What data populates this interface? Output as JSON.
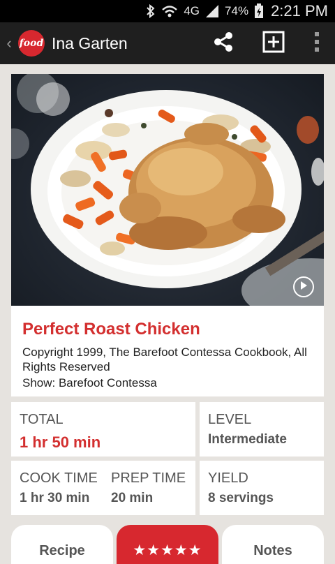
{
  "status_bar": {
    "network": "4G",
    "battery": "74%",
    "time": "2:21 PM"
  },
  "app_bar": {
    "logo_text": "food",
    "title": "Ina Garten",
    "icons": [
      "back-icon",
      "share-icon",
      "add-icon",
      "overflow-menu-icon"
    ]
  },
  "recipe": {
    "title": "Perfect Roast Chicken",
    "copyright": "Copyright 1999, The Barefoot Contessa Cookbook, All Rights Reserved",
    "show": "Show: Barefoot Contessa",
    "image_alt": "roast chicken on platter with carrots and onions"
  },
  "details": {
    "total_label": "TOTAL",
    "total_value": "1 hr 50 min",
    "level_label": "LEVEL",
    "level_value": "Intermediate",
    "cook_label": "COOK TIME",
    "cook_value": "1 hr 30 min",
    "prep_label": "PREP TIME",
    "prep_value": "20 min",
    "yield_label": "YIELD",
    "yield_value": "8 servings"
  },
  "tabs": {
    "recipe": "Recipe",
    "rating": "★★★★★",
    "notes": "Notes"
  },
  "colors": {
    "accent": "#d32f2f",
    "app_bar": "#1f1f1f",
    "background": "#e6e3df"
  }
}
